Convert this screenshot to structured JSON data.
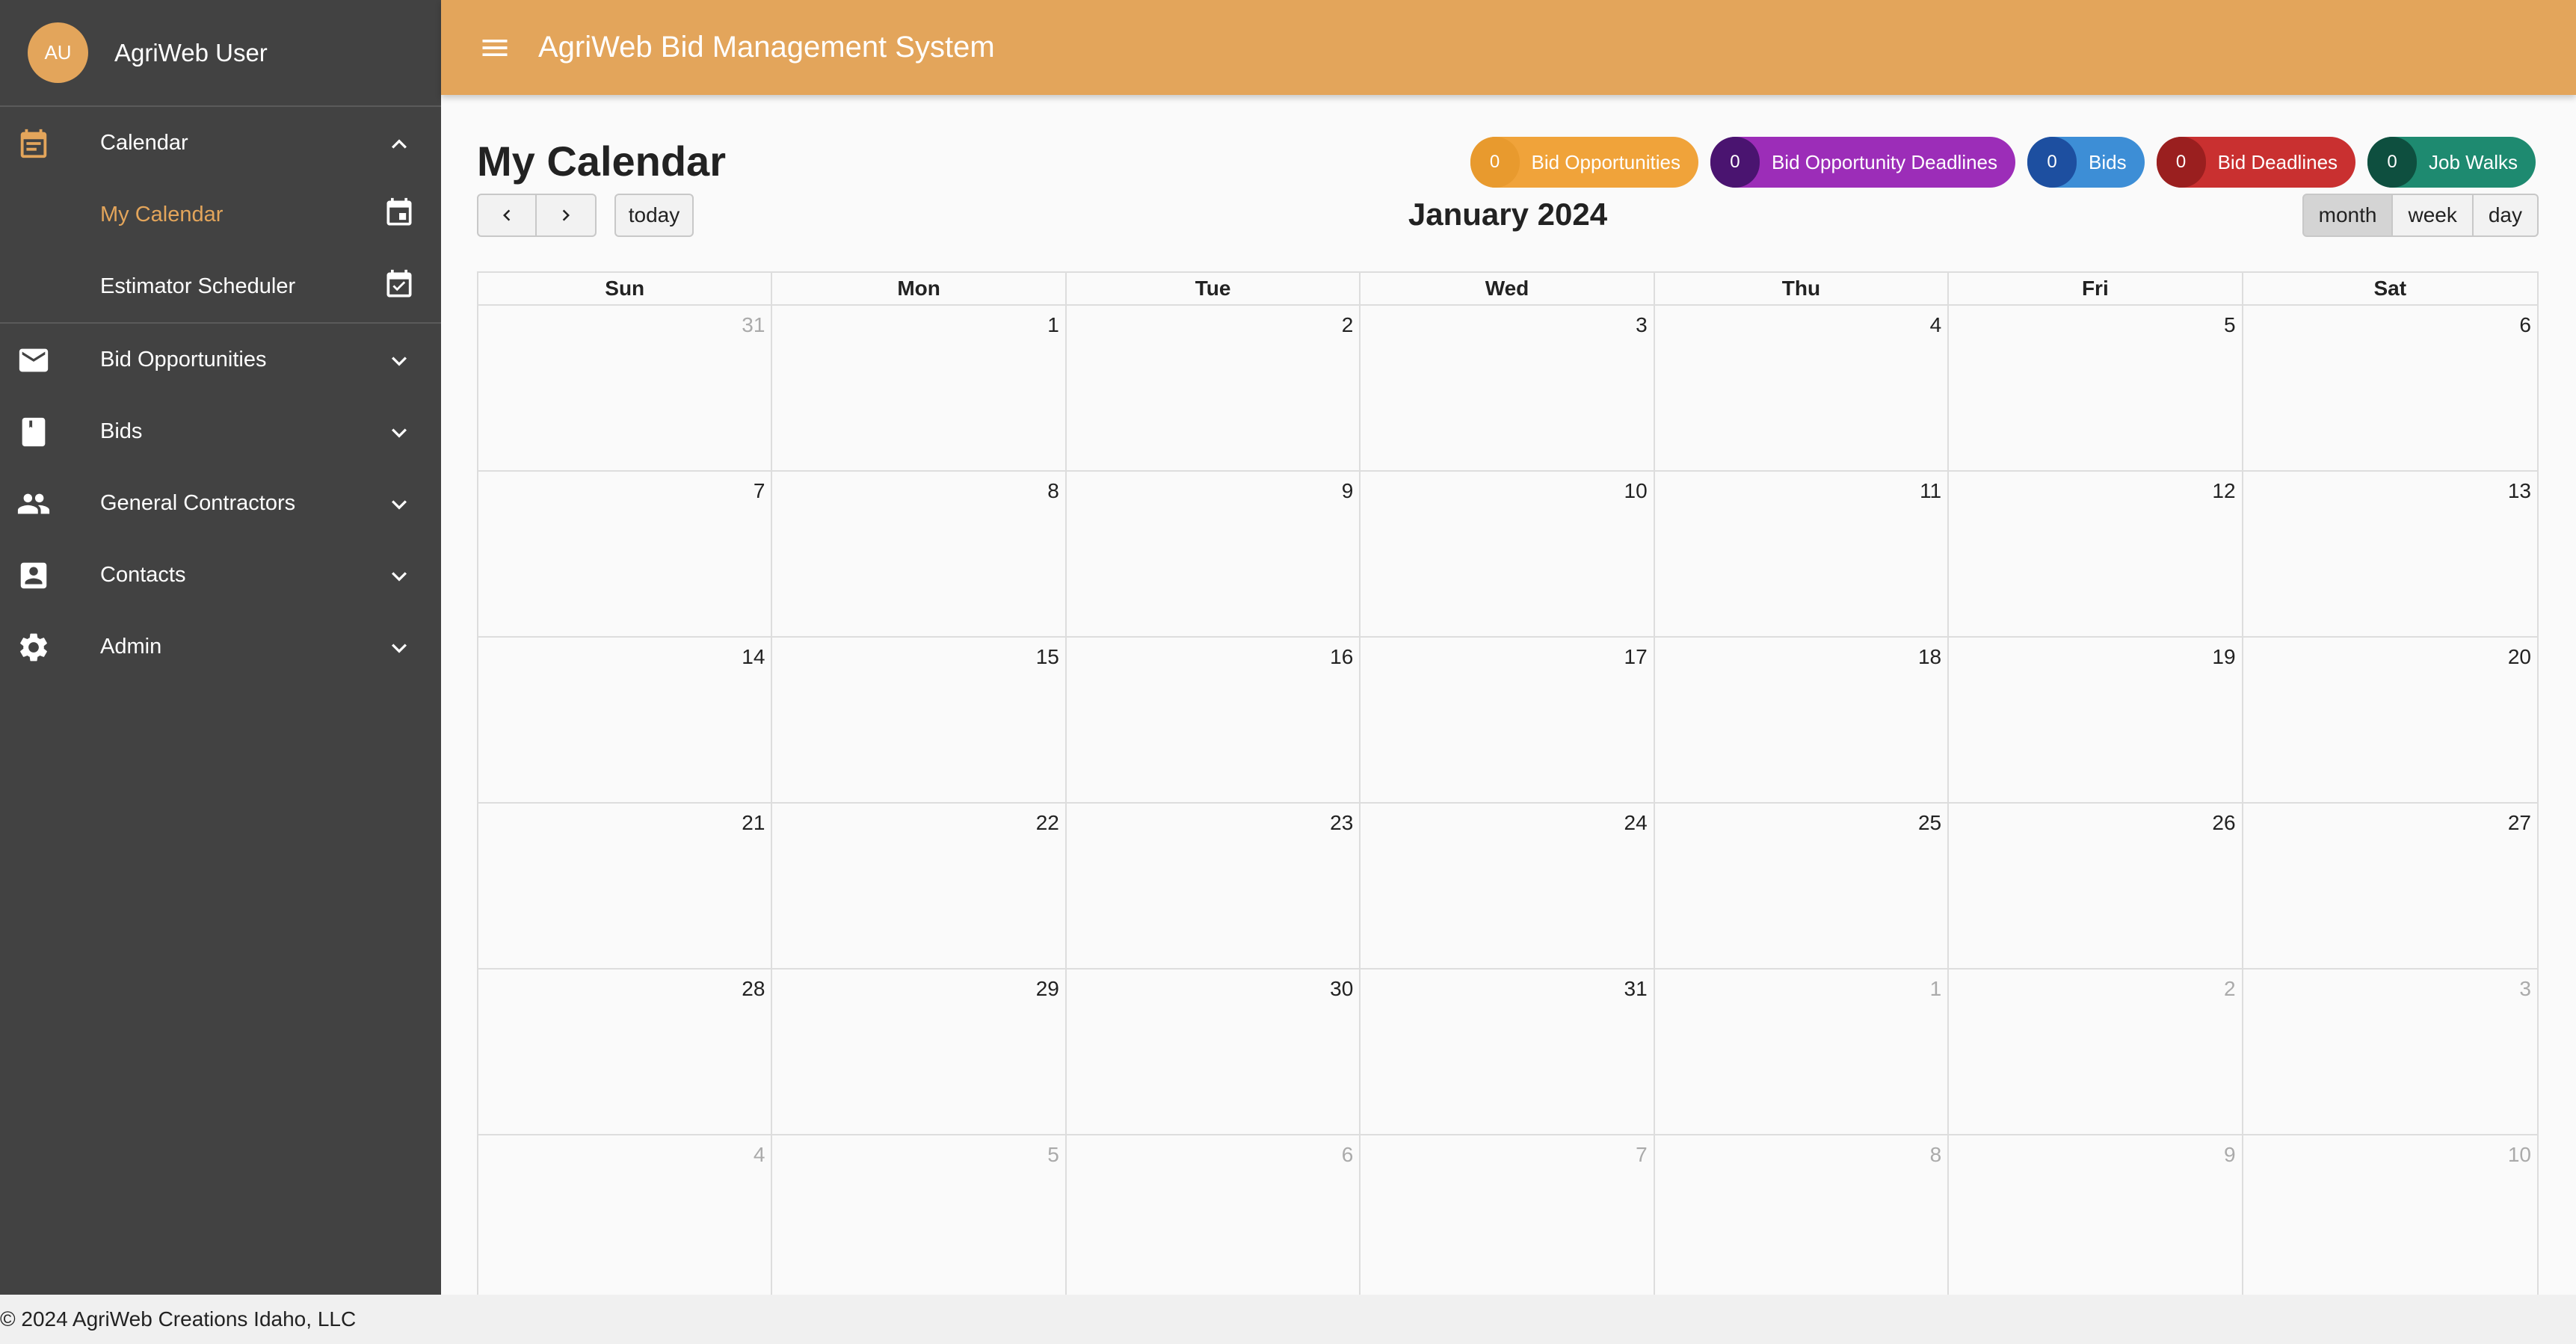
{
  "user": {
    "initials": "AU",
    "name": "AgriWeb User"
  },
  "sidebar": {
    "items": [
      {
        "label": "Calendar",
        "icon": "calendar-icon",
        "expanded": true
      },
      {
        "label": "My Calendar",
        "icon": "event-icon",
        "active": true
      },
      {
        "label": "Estimator Scheduler",
        "icon": "event-check-icon"
      },
      {
        "label": "Bid Opportunities",
        "icon": "mail-icon"
      },
      {
        "label": "Bids",
        "icon": "bookmark-icon"
      },
      {
        "label": "General Contractors",
        "icon": "people-icon"
      },
      {
        "label": "Contacts",
        "icon": "contact-card-icon"
      },
      {
        "label": "Admin",
        "icon": "gear-icon"
      }
    ]
  },
  "header": {
    "title": "AgriWeb Bid Management System"
  },
  "page": {
    "title": "My Calendar"
  },
  "legend": [
    {
      "count": "0",
      "label": "Bid Opportunities",
      "color": "#f0a33a",
      "dark": "#e89a2e"
    },
    {
      "count": "0",
      "label": "Bid Opportunity Deadlines",
      "color": "#9c2db8",
      "dark": "#4a1470"
    },
    {
      "count": "0",
      "label": "Bids",
      "color": "#3d8ed6",
      "dark": "#1d4fa0"
    },
    {
      "count": "0",
      "label": "Bid Deadlines",
      "color": "#c93030",
      "dark": "#9a1f1f"
    },
    {
      "count": "0",
      "label": "Job Walks",
      "color": "#1e8a70",
      "dark": "#0e4f3f"
    }
  ],
  "toolbar": {
    "today": "today",
    "month_title": "January 2024",
    "views": [
      "month",
      "week",
      "day"
    ]
  },
  "weekdays": [
    "Sun",
    "Mon",
    "Tue",
    "Wed",
    "Thu",
    "Fri",
    "Sat"
  ],
  "weeks": [
    [
      "31",
      "1",
      "2",
      "3",
      "4",
      "5",
      "6"
    ],
    [
      "7",
      "8",
      "9",
      "10",
      "11",
      "12",
      "13"
    ],
    [
      "14",
      "15",
      "16",
      "17",
      "18",
      "19",
      "20"
    ],
    [
      "21",
      "22",
      "23",
      "24",
      "25",
      "26",
      "27"
    ],
    [
      "28",
      "29",
      "30",
      "31",
      "1",
      "2",
      "3"
    ],
    [
      "4",
      "5",
      "6",
      "7",
      "8",
      "9",
      "10"
    ]
  ],
  "footer": {
    "text": "© 2024 AgriWeb Creations Idaho, LLC"
  }
}
